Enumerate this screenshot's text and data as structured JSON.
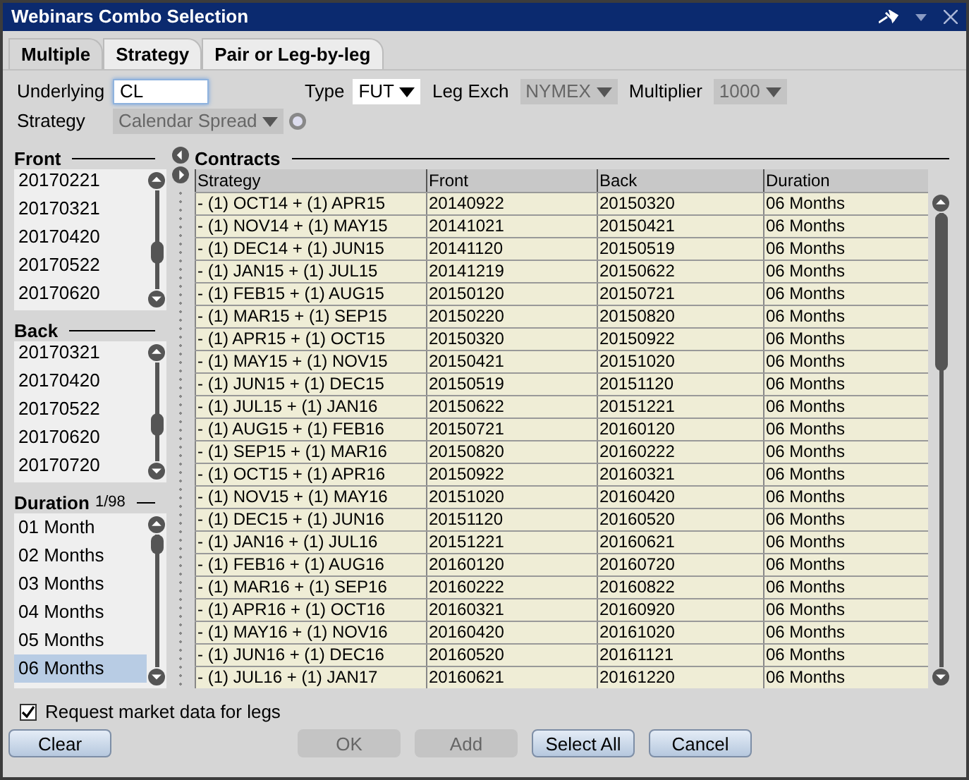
{
  "window": {
    "title": "Webinars Combo Selection"
  },
  "tabs": [
    {
      "label": "Multiple",
      "selected": true
    },
    {
      "label": "Strategy",
      "selected": false
    },
    {
      "label": "Pair or Leg-by-leg",
      "selected": false
    }
  ],
  "form": {
    "underlying": {
      "label": "Underlying",
      "value": "CL"
    },
    "type": {
      "label": "Type",
      "value": "FUT",
      "disabled": false
    },
    "leg_exch": {
      "label": "Leg Exch",
      "value": "NYMEX",
      "disabled": true
    },
    "multiplier": {
      "label": "Multiplier",
      "value": "1000",
      "disabled": true
    },
    "strategy": {
      "label": "Strategy",
      "value": "Calendar Spread",
      "disabled": true
    }
  },
  "front": {
    "title": "Front",
    "items": [
      {
        "label": "20170221",
        "selected": false
      },
      {
        "label": "20170321",
        "selected": false
      },
      {
        "label": "20170420",
        "selected": false
      },
      {
        "label": "20170522",
        "selected": false
      },
      {
        "label": "20170620",
        "selected": false
      }
    ]
  },
  "back": {
    "title": "Back",
    "items": [
      {
        "label": "20170321",
        "selected": false
      },
      {
        "label": "20170420",
        "selected": false
      },
      {
        "label": "20170522",
        "selected": false
      },
      {
        "label": "20170620",
        "selected": false
      },
      {
        "label": "20170720",
        "selected": false
      }
    ]
  },
  "duration": {
    "title": "Duration",
    "count": "1/98",
    "items": [
      {
        "label": "01 Month",
        "selected": false
      },
      {
        "label": "02 Months",
        "selected": false
      },
      {
        "label": "03 Months",
        "selected": false
      },
      {
        "label": "04 Months",
        "selected": false
      },
      {
        "label": "05 Months",
        "selected": false
      },
      {
        "label": "06 Months",
        "selected": true
      }
    ]
  },
  "contracts": {
    "title": "Contracts",
    "columns": [
      "Strategy",
      "Front",
      "Back",
      "Duration"
    ],
    "rows": [
      [
        "- (1) OCT14 + (1) APR15",
        "20140922",
        "20150320",
        "06 Months"
      ],
      [
        "- (1) NOV14 + (1) MAY15",
        "20141021",
        "20150421",
        "06 Months"
      ],
      [
        "- (1) DEC14 + (1) JUN15",
        "20141120",
        "20150519",
        "06 Months"
      ],
      [
        "- (1) JAN15 + (1) JUL15",
        "20141219",
        "20150622",
        "06 Months"
      ],
      [
        "- (1) FEB15 + (1) AUG15",
        "20150120",
        "20150721",
        "06 Months"
      ],
      [
        "- (1) MAR15 + (1) SEP15",
        "20150220",
        "20150820",
        "06 Months"
      ],
      [
        "- (1) APR15 + (1) OCT15",
        "20150320",
        "20150922",
        "06 Months"
      ],
      [
        "- (1) MAY15 + (1) NOV15",
        "20150421",
        "20151020",
        "06 Months"
      ],
      [
        "- (1) JUN15 + (1) DEC15",
        "20150519",
        "20151120",
        "06 Months"
      ],
      [
        "- (1) JUL15 + (1) JAN16",
        "20150622",
        "20151221",
        "06 Months"
      ],
      [
        "- (1) AUG15 + (1) FEB16",
        "20150721",
        "20160120",
        "06 Months"
      ],
      [
        "- (1) SEP15 + (1) MAR16",
        "20150820",
        "20160222",
        "06 Months"
      ],
      [
        "- (1) OCT15 + (1) APR16",
        "20150922",
        "20160321",
        "06 Months"
      ],
      [
        "- (1) NOV15 + (1) MAY16",
        "20151020",
        "20160420",
        "06 Months"
      ],
      [
        "- (1) DEC15 + (1) JUN16",
        "20151120",
        "20160520",
        "06 Months"
      ],
      [
        "- (1) JAN16 + (1) JUL16",
        "20151221",
        "20160621",
        "06 Months"
      ],
      [
        "- (1) FEB16 + (1) AUG16",
        "20160120",
        "20160720",
        "06 Months"
      ],
      [
        "- (1) MAR16 + (1) SEP16",
        "20160222",
        "20160822",
        "06 Months"
      ],
      [
        "- (1) APR16 + (1) OCT16",
        "20160321",
        "20160920",
        "06 Months"
      ],
      [
        "- (1) MAY16 + (1) NOV16",
        "20160420",
        "20161020",
        "06 Months"
      ],
      [
        "- (1) JUN16 + (1) DEC16",
        "20160520",
        "20161121",
        "06 Months"
      ],
      [
        "- (1) JUL16 + (1) JAN17",
        "20160621",
        "20161220",
        "06 Months"
      ]
    ]
  },
  "request_market_data": {
    "label": "Request market data for legs",
    "checked": true
  },
  "buttons": [
    {
      "label": "Clear",
      "disabled": false
    },
    {
      "label": "OK",
      "disabled": true
    },
    {
      "label": "Add",
      "disabled": true
    },
    {
      "label": "Select All",
      "disabled": false
    },
    {
      "label": "Cancel",
      "disabled": false
    }
  ]
}
